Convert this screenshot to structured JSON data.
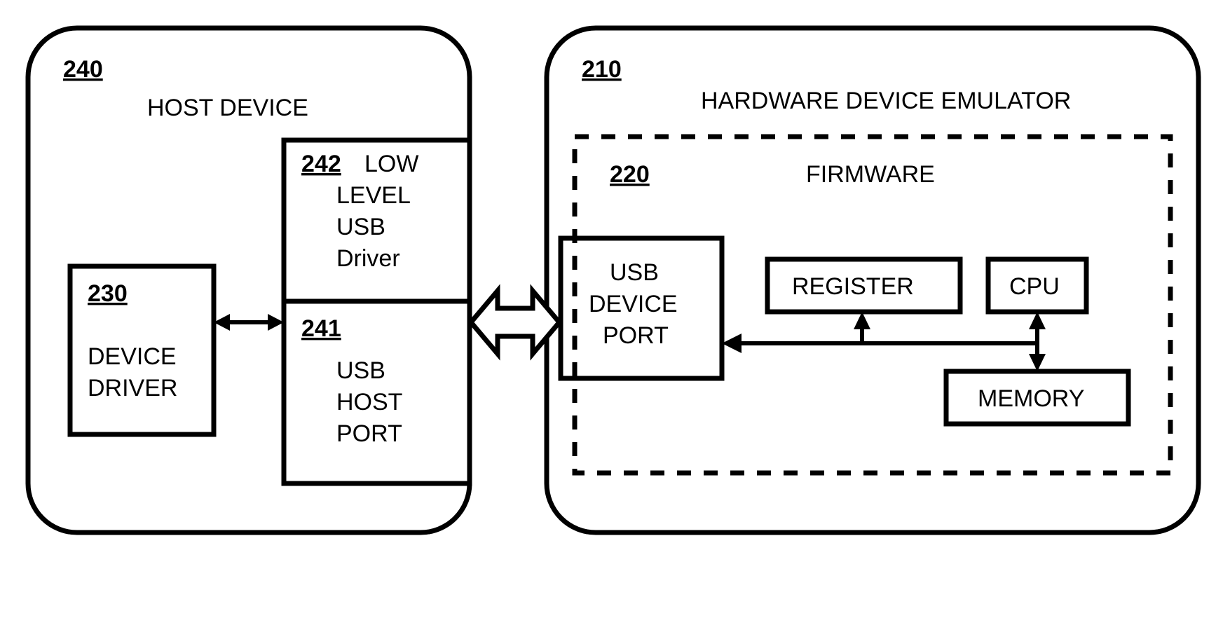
{
  "host": {
    "ref": "240",
    "title": "HOST DEVICE",
    "deviceDriver": {
      "ref": "230",
      "line1": "DEVICE",
      "line2": "DRIVER"
    },
    "lowLevel": {
      "ref": "242",
      "line1": "LOW",
      "line2": "LEVEL",
      "line3": "USB",
      "line4": "Driver"
    },
    "hostPort": {
      "ref": "241",
      "line1": "USB",
      "line2": "HOST",
      "line3": "PORT"
    }
  },
  "emu": {
    "ref": "210",
    "title": "HARDWARE DEVICE EMULATOR",
    "firmware": {
      "ref": "220",
      "title": "FIRMWARE",
      "usbDevicePort": {
        "line1": "USB",
        "line2": "DEVICE",
        "line3": "PORT"
      },
      "register": "REGISTER",
      "cpu": "CPU",
      "memory": "MEMORY"
    }
  }
}
